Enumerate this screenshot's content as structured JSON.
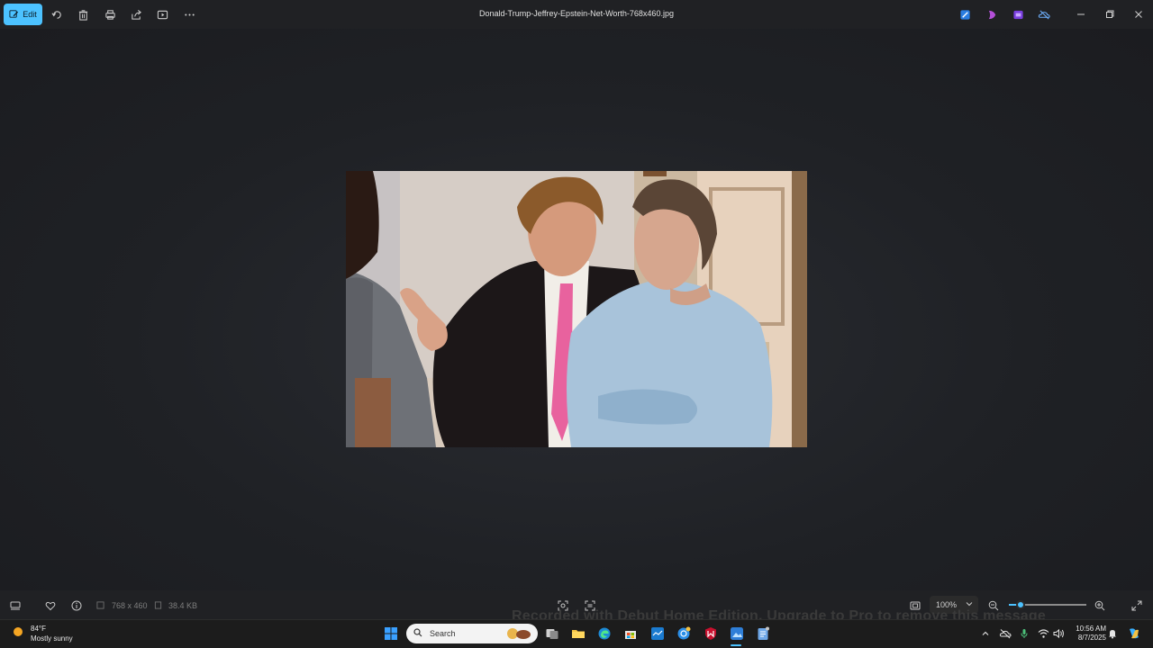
{
  "toolbar": {
    "edit_label": "Edit",
    "file_title": "Donald-Trump-Jeffrey-Epstein-Net-Worth-768x460.jpg"
  },
  "status": {
    "dimensions": "768 x 460",
    "file_size": "38.4 KB",
    "zoom": "100%",
    "zoom_level": 0.15
  },
  "watermark": "Recorded with Debut Home Edition. Upgrade to Pro to remove this message",
  "taskbar": {
    "search_placeholder": "Search",
    "weather_temp": "84°F",
    "weather_desc": "Mostly sunny",
    "time": "10:56 AM",
    "date": "8/7/2025"
  },
  "colors": {
    "accent": "#4cc2ff",
    "background": "#202124"
  }
}
